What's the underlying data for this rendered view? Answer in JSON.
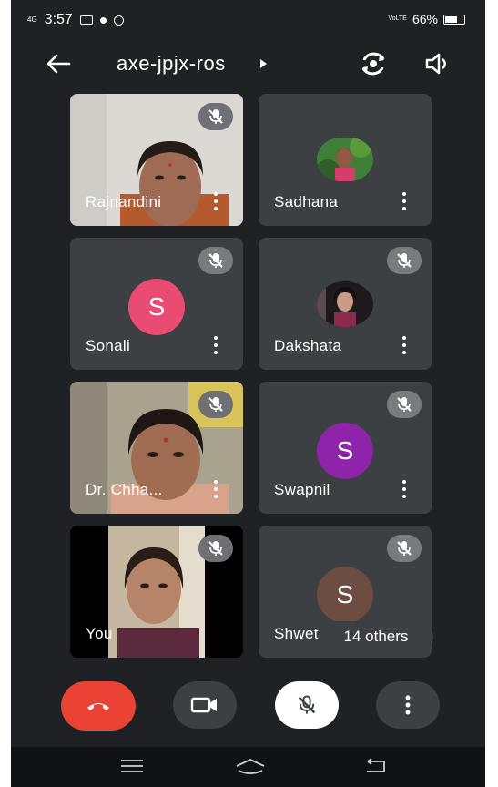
{
  "status_bar": {
    "network": "4G",
    "time": "3:57",
    "volte": "VoLTE",
    "battery": "66%"
  },
  "header": {
    "meeting_code": "axe-jpjx-ros"
  },
  "participants": [
    {
      "name": "Rajnandini",
      "type": "video",
      "muted": true
    },
    {
      "name": "Sadhana",
      "type": "photo",
      "muted": false
    },
    {
      "name": "Sonali",
      "type": "initial",
      "initial": "S",
      "color": "#ea4b72",
      "muted": true
    },
    {
      "name": "Dakshata",
      "type": "photo",
      "muted": true
    },
    {
      "name": "Dr. Chha...",
      "type": "video",
      "muted": true
    },
    {
      "name": "Swapnil",
      "type": "initial",
      "initial": "S",
      "color": "#8e24aa",
      "muted": true
    },
    {
      "name": "You",
      "type": "video",
      "muted": true
    },
    {
      "name": "Shwet",
      "type": "initial",
      "initial": "S",
      "color": "#6d4c41",
      "muted": true
    }
  ],
  "others_pill": "14 others",
  "controls": {
    "end_call_color": "#ea4335",
    "items": [
      "end-call",
      "camera",
      "microphone",
      "more-options"
    ]
  },
  "icons": [
    "back-arrow-icon",
    "switch-camera-icon",
    "speaker-icon",
    "mic-off-icon",
    "more-vert-icon",
    "phone-hangup-icon",
    "video-camera-icon",
    "menu-icon",
    "home-icon",
    "back-nav-icon"
  ]
}
